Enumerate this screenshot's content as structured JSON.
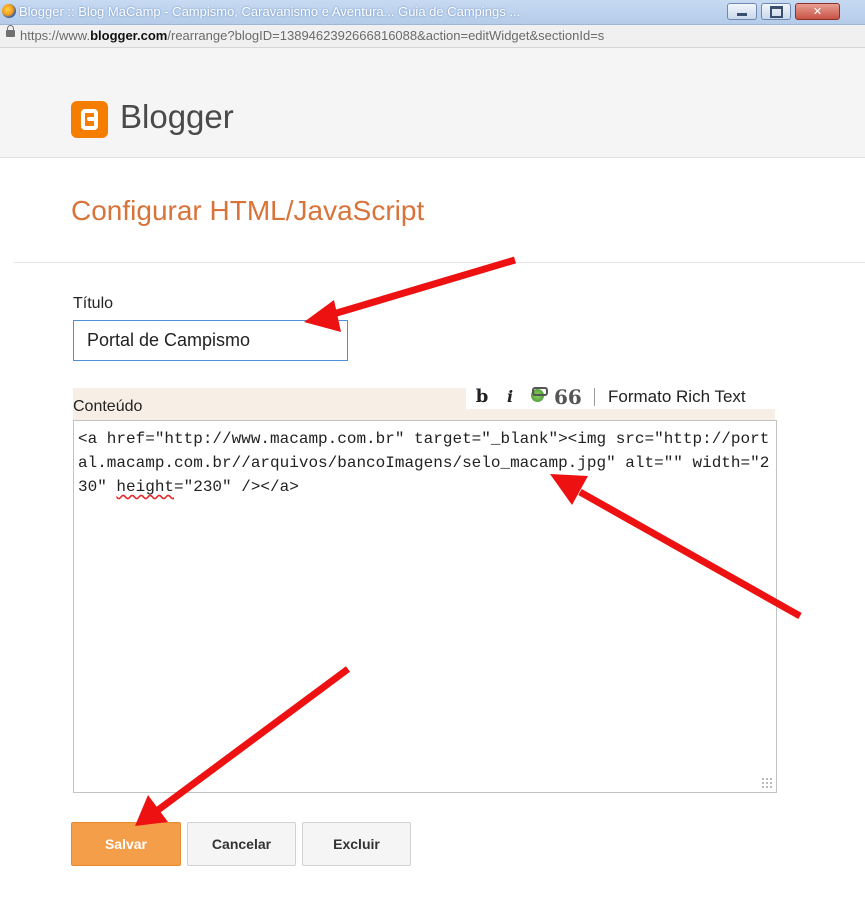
{
  "window": {
    "title": "Blogger :: Blog MaCamp - Campismo, Caravanismo e Aventura... Guia de Campings ..."
  },
  "address_bar": {
    "url_prefix": "https://www.",
    "url_host": "blogger.com",
    "url_rest": "/rearrange?blogID=1389462392666816088&action=editWidget&sectionId=s"
  },
  "brand": {
    "logo_text": "Blogger"
  },
  "page": {
    "title": "Configurar HTML/JavaScript"
  },
  "form": {
    "title_label": "Título",
    "title_value": "Portal de Campismo",
    "content_label": "Conteúdo",
    "content_before": "<a href=\"http://www.macamp.com.br\" target=\"_blank\"><img src=\"http://portal.macamp.com.br//arquivos/bancoImagens/selo_macamp.jpg\" alt=\"\" width=\"230\" ",
    "content_flagged": "height",
    "content_after": "=\"230\" /></a>"
  },
  "toolbar": {
    "bold_label": "b",
    "italic_label": "i",
    "quote_label": "66",
    "rich_text_label": "Formato Rich Text"
  },
  "buttons": {
    "save_label": "Salvar",
    "cancel_label": "Cancelar",
    "delete_label": "Excluir"
  },
  "colors": {
    "accent_orange": "#f57d00",
    "save_button": "#f59e4a",
    "annotation_arrow": "#ee1111"
  }
}
